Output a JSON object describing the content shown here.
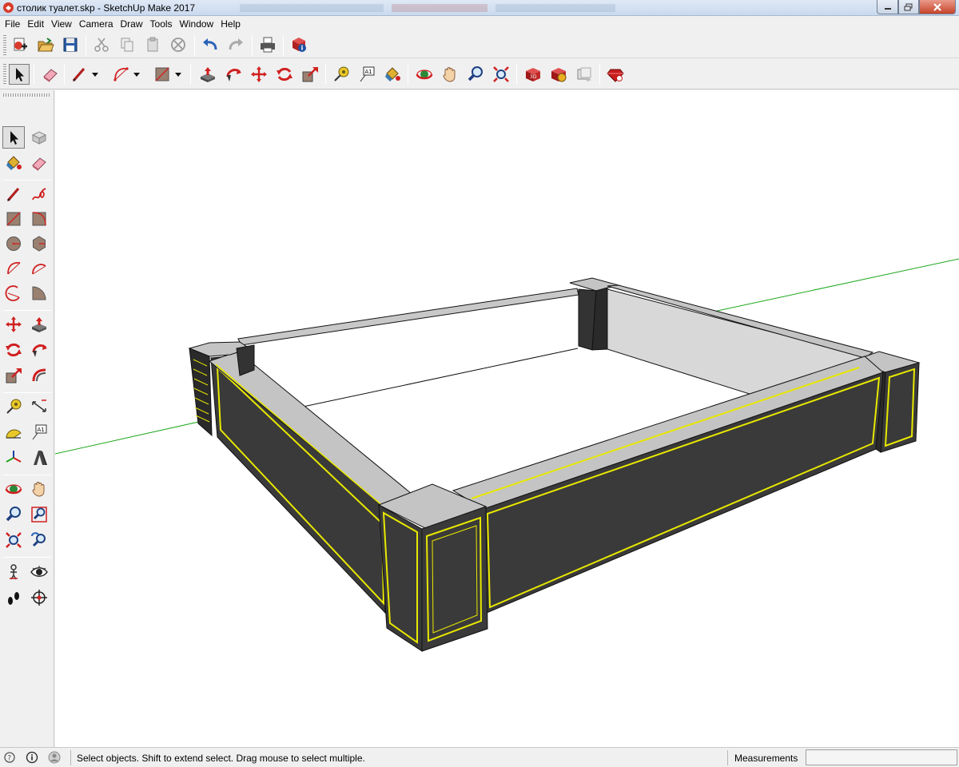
{
  "window": {
    "title": "столик туалет.skp - SketchUp Make 2017"
  },
  "menu": {
    "items": [
      "File",
      "Edit",
      "View",
      "Camera",
      "Draw",
      "Tools",
      "Window",
      "Help"
    ]
  },
  "toolbar_top": {
    "icons": [
      "new-file-icon",
      "open-icon",
      "save-icon",
      "cut-icon",
      "copy-icon",
      "paste-icon",
      "erase-icon",
      "undo-icon",
      "redo-icon",
      "print-icon",
      "model-info-icon"
    ]
  },
  "toolbar_main": {
    "icons": [
      "select-icon",
      "eraser-icon",
      "line-icon",
      "arc-icon",
      "rectangle-icon",
      "push-pull-icon",
      "follow-me-icon",
      "move-icon",
      "rotate-icon",
      "scale-icon",
      "tape-measure-icon",
      "text-icon",
      "paint-bucket-icon",
      "orbit-icon",
      "pan-icon",
      "zoom-icon",
      "zoom-extents-icon",
      "warehouse-icon",
      "extension-warehouse-icon",
      "layout-icon",
      "ruby-icon"
    ]
  },
  "toolbar_left": {
    "icons": [
      "select-icon",
      "component-icon",
      "paint-bucket-icon",
      "eraser-icon",
      "line-icon",
      "freehand-icon",
      "rectangle-icon",
      "rotated-rectangle-icon",
      "circle-icon",
      "polygon-icon",
      "arc-icon",
      "two-point-arc-icon",
      "three-point-arc-icon",
      "pie-icon",
      "move-icon",
      "push-pull-icon",
      "rotate-icon",
      "follow-me-icon",
      "scale-icon",
      "offset-icon",
      "tape-measure-icon",
      "dimension-icon",
      "protractor-icon",
      "text-icon",
      "axes-icon",
      "3d-text-icon",
      "orbit-icon",
      "pan-icon",
      "zoom-icon",
      "zoom-window-icon",
      "zoom-extents-icon",
      "previous-view-icon",
      "position-camera-icon",
      "look-around-icon",
      "walk-icon",
      "section-plane-icon"
    ]
  },
  "status": {
    "message": "Select objects. Shift to extend select. Drag mouse to select multiple.",
    "measurements_label": "Measurements",
    "measurements_value": ""
  },
  "colors": {
    "panel_dark": "#3a3a3a",
    "cap_grey": "#c4c4c4",
    "inner_wall": "#d9d9d9",
    "highlight_yellow": "#e8e800",
    "axis_green": "#1ea81e"
  }
}
